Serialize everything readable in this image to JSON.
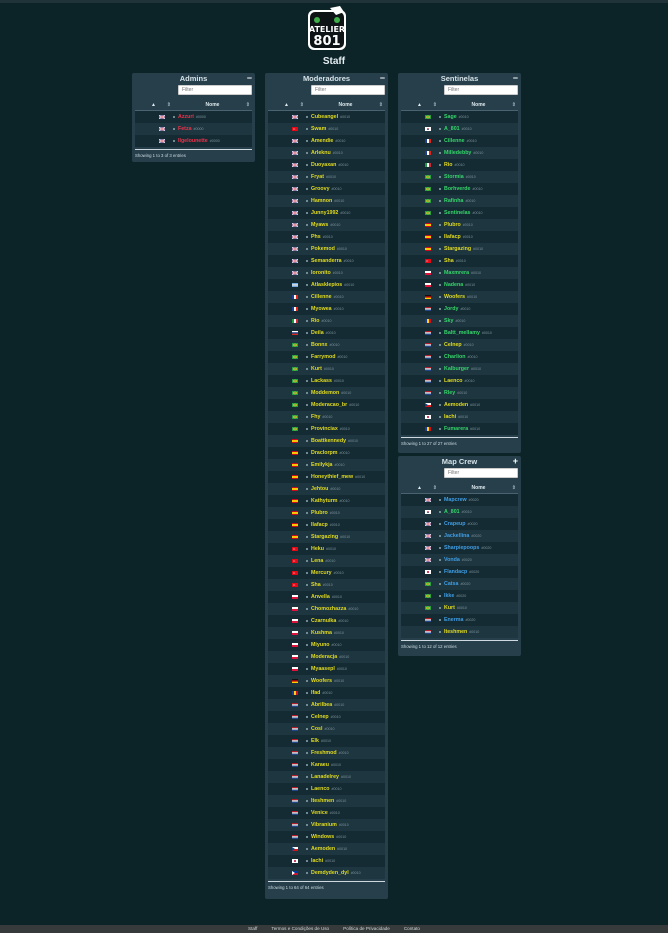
{
  "page": {
    "title": "Staff"
  },
  "logo": {
    "line1": "ATELIER",
    "line2": "801"
  },
  "colors": {
    "yellow": "#e2dc1d",
    "green": "#35d66a",
    "red": "#f0304a",
    "blue": "#3f9ee6",
    "panel": "#263f4b",
    "background": "#0c2328"
  },
  "panels": {
    "admins": {
      "title": "Admins",
      "toggle": "−",
      "filter_placeholder": "Filter",
      "col_name": "Nome",
      "info": "Showing 1 to 3 of 3 entries",
      "rows": [
        {
          "flag": "flag-uk",
          "name": "Azzuri",
          "tag": "#0000",
          "color": "#f0304a"
        },
        {
          "flag": "flag-uk",
          "name": "Fetza",
          "tag": "#0000",
          "color": "#f0304a"
        },
        {
          "flag": "flag-uk",
          "name": "Ilgelounette",
          "tag": "#0000",
          "color": "#f0304a"
        }
      ]
    },
    "moderadores": {
      "title": "Moderadores",
      "toggle": "−",
      "filter_placeholder": "Filter",
      "col_name": "Nome",
      "info": "Showing 1 to 64 of 64 entries",
      "rows": [
        {
          "flag": "flag-uk",
          "name": "Cubeangel",
          "tag": "#0010",
          "color": "#e2dc1d"
        },
        {
          "flag": "flag-tr",
          "name": "Swam",
          "tag": "#0010",
          "color": "#e2dc1d"
        },
        {
          "flag": "flag-uk",
          "name": "Amendie",
          "tag": "#0010",
          "color": "#e2dc1d"
        },
        {
          "flag": "flag-uk",
          "name": "Arleknu",
          "tag": "#0010",
          "color": "#e2dc1d"
        },
        {
          "flag": "flag-uk",
          "name": "Duoyaxan",
          "tag": "#0010",
          "color": "#e2dc1d"
        },
        {
          "flag": "flag-uk",
          "name": "Fryat",
          "tag": "#0010",
          "color": "#e2dc1d"
        },
        {
          "flag": "flag-uk",
          "name": "Groovy",
          "tag": "#0010",
          "color": "#e2dc1d"
        },
        {
          "flag": "flag-uk",
          "name": "Hamnon",
          "tag": "#0010",
          "color": "#e2dc1d"
        },
        {
          "flag": "flag-uk",
          "name": "Junny1992",
          "tag": "#0010",
          "color": "#e2dc1d"
        },
        {
          "flag": "flag-uk",
          "name": "Myaws",
          "tag": "#0010",
          "color": "#e2dc1d"
        },
        {
          "flag": "flag-uk",
          "name": "Phs",
          "tag": "#0010",
          "color": "#e2dc1d"
        },
        {
          "flag": "flag-uk",
          "name": "Pokemod",
          "tag": "#0010",
          "color": "#e2dc1d"
        },
        {
          "flag": "flag-uk",
          "name": "Semanderra",
          "tag": "#0010",
          "color": "#e2dc1d"
        },
        {
          "flag": "flag-uk",
          "name": "Ioronito",
          "tag": "#0010",
          "color": "#e2dc1d"
        },
        {
          "flag": "flag-ar",
          "name": "Atlasklepios",
          "tag": "#0010",
          "color": "#e2dc1d"
        },
        {
          "flag": "flag-fr",
          "name": "Cillenne",
          "tag": "#0010",
          "color": "#e2dc1d"
        },
        {
          "flag": "flag-fr",
          "name": "Myowea",
          "tag": "#0010",
          "color": "#e2dc1d"
        },
        {
          "flag": "flag-it",
          "name": "Rio",
          "tag": "#0010",
          "color": "#e2dc1d"
        },
        {
          "flag": "flag-ru",
          "name": "Deila",
          "tag": "#0010",
          "color": "#e2dc1d"
        },
        {
          "flag": "flag-br",
          "name": "Bonnx",
          "tag": "#0010",
          "color": "#e2dc1d"
        },
        {
          "flag": "flag-br",
          "name": "Farrymod",
          "tag": "#0010",
          "color": "#e2dc1d"
        },
        {
          "flag": "flag-br",
          "name": "Kurt",
          "tag": "#0010",
          "color": "#e2dc1d"
        },
        {
          "flag": "flag-br",
          "name": "Lackass",
          "tag": "#0010",
          "color": "#e2dc1d"
        },
        {
          "flag": "flag-br",
          "name": "Moddemon",
          "tag": "#0010",
          "color": "#e2dc1d"
        },
        {
          "flag": "flag-br",
          "name": "Moderacao_br",
          "tag": "#0010",
          "color": "#e2dc1d"
        },
        {
          "flag": "flag-br",
          "name": "Fhy",
          "tag": "#0010",
          "color": "#e2dc1d"
        },
        {
          "flag": "flag-br",
          "name": "Provinciax",
          "tag": "#0010",
          "color": "#e2dc1d"
        },
        {
          "flag": "flag-es",
          "name": "Boattkennedy",
          "tag": "#0010",
          "color": "#e2dc1d"
        },
        {
          "flag": "flag-es",
          "name": "Draclorpm",
          "tag": "#0010",
          "color": "#e2dc1d"
        },
        {
          "flag": "flag-es",
          "name": "Emilykja",
          "tag": "#0010",
          "color": "#e2dc1d"
        },
        {
          "flag": "flag-es",
          "name": "Honeythief_mew",
          "tag": "#0010",
          "color": "#e2dc1d"
        },
        {
          "flag": "flag-es",
          "name": "Jehtou",
          "tag": "#0010",
          "color": "#e2dc1d"
        },
        {
          "flag": "flag-es",
          "name": "Kathyturm",
          "tag": "#0010",
          "color": "#e2dc1d"
        },
        {
          "flag": "flag-es",
          "name": "Plubro",
          "tag": "#0010",
          "color": "#e2dc1d"
        },
        {
          "flag": "flag-es",
          "name": "Ilafacp",
          "tag": "#0010",
          "color": "#e2dc1d"
        },
        {
          "flag": "flag-es",
          "name": "Stargazing",
          "tag": "#0010",
          "color": "#e2dc1d"
        },
        {
          "flag": "flag-tr",
          "name": "Heku",
          "tag": "#0010",
          "color": "#e2dc1d"
        },
        {
          "flag": "flag-tr",
          "name": "Lena",
          "tag": "#0010",
          "color": "#e2dc1d"
        },
        {
          "flag": "flag-tr",
          "name": "Mercury",
          "tag": "#0010",
          "color": "#e2dc1d"
        },
        {
          "flag": "flag-tr",
          "name": "Sha",
          "tag": "#0010",
          "color": "#e2dc1d"
        },
        {
          "flag": "flag-pl",
          "name": "Anvella",
          "tag": "#0010",
          "color": "#e2dc1d"
        },
        {
          "flag": "flag-pl",
          "name": "Chomozhazza",
          "tag": "#0010",
          "color": "#e2dc1d"
        },
        {
          "flag": "flag-pl",
          "name": "Czarnulka",
          "tag": "#0010",
          "color": "#e2dc1d"
        },
        {
          "flag": "flag-pl",
          "name": "Kushma",
          "tag": "#0010",
          "color": "#e2dc1d"
        },
        {
          "flag": "flag-pl",
          "name": "Miyuno",
          "tag": "#0010",
          "color": "#e2dc1d"
        },
        {
          "flag": "flag-pl",
          "name": "Moderacja",
          "tag": "#0010",
          "color": "#e2dc1d"
        },
        {
          "flag": "flag-pl",
          "name": "Myaasepl",
          "tag": "#0010",
          "color": "#e2dc1d"
        },
        {
          "flag": "flag-de",
          "name": "Woofers",
          "tag": "#0010",
          "color": "#e2dc1d"
        },
        {
          "flag": "flag-ro",
          "name": "Ifad",
          "tag": "#0010",
          "color": "#e2dc1d"
        },
        {
          "flag": "flag-nl",
          "name": "Abrilbea",
          "tag": "#0010",
          "color": "#e2dc1d"
        },
        {
          "flag": "flag-nl",
          "name": "Celnep",
          "tag": "#0010",
          "color": "#e2dc1d"
        },
        {
          "flag": "flag-nl",
          "name": "Cosl",
          "tag": "#0010",
          "color": "#e2dc1d"
        },
        {
          "flag": "flag-nl",
          "name": "Elk",
          "tag": "#0010",
          "color": "#e2dc1d"
        },
        {
          "flag": "flag-nl",
          "name": "Freshmod",
          "tag": "#0010",
          "color": "#e2dc1d"
        },
        {
          "flag": "flag-nl",
          "name": "Karaeu",
          "tag": "#0010",
          "color": "#e2dc1d"
        },
        {
          "flag": "flag-nl",
          "name": "Lanadelrey",
          "tag": "#0010",
          "color": "#e2dc1d"
        },
        {
          "flag": "flag-nl",
          "name": "Laenco",
          "tag": "#0010",
          "color": "#e2dc1d"
        },
        {
          "flag": "flag-nl",
          "name": "Iteshmen",
          "tag": "#0010",
          "color": "#e2dc1d"
        },
        {
          "flag": "flag-nl",
          "name": "Venice",
          "tag": "#0010",
          "color": "#e2dc1d"
        },
        {
          "flag": "flag-nl",
          "name": "Vibranium",
          "tag": "#0010",
          "color": "#e2dc1d"
        },
        {
          "flag": "flag-nl",
          "name": "Windows",
          "tag": "#0010",
          "color": "#e2dc1d"
        },
        {
          "flag": "flag-cz",
          "name": "Aemoden",
          "tag": "#0010",
          "color": "#e2dc1d"
        },
        {
          "flag": "flag-jp",
          "name": "Iachi",
          "tag": "#0010",
          "color": "#e2dc1d"
        },
        {
          "flag": "flag-ph",
          "name": "Demdyden_dyl",
          "tag": "#0010",
          "color": "#e2dc1d"
        }
      ]
    },
    "sentinelas": {
      "title": "Sentinelas",
      "toggle": "−",
      "filter_placeholder": "Filter",
      "col_name": "Nome",
      "info": "Showing 1 to 27 of 27 entries",
      "rows": [
        {
          "flag": "flag-br",
          "name": "Sage",
          "tag": "#0010",
          "color": "#35d66a"
        },
        {
          "flag": "flag-kr",
          "name": "A_801",
          "tag": "#0010",
          "color": "#35d66a"
        },
        {
          "flag": "flag-fr",
          "name": "Cillenne",
          "tag": "#0010",
          "color": "#35d66a"
        },
        {
          "flag": "flag-fr",
          "name": "Milledebby",
          "tag": "#0010",
          "color": "#35d66a"
        },
        {
          "flag": "flag-it",
          "name": "Rio",
          "tag": "#0010",
          "color": "#e2dc1d"
        },
        {
          "flag": "flag-br",
          "name": "Stormia",
          "tag": "#0010",
          "color": "#35d66a"
        },
        {
          "flag": "flag-br",
          "name": "Borhverde",
          "tag": "#0010",
          "color": "#35d66a"
        },
        {
          "flag": "flag-br",
          "name": "Rafinha",
          "tag": "#0010",
          "color": "#35d66a"
        },
        {
          "flag": "flag-br",
          "name": "Sentinelas",
          "tag": "#0010",
          "color": "#35d66a"
        },
        {
          "flag": "flag-es",
          "name": "Plubro",
          "tag": "#0010",
          "color": "#e2dc1d"
        },
        {
          "flag": "flag-es",
          "name": "Ilafacp",
          "tag": "#0010",
          "color": "#e2dc1d"
        },
        {
          "flag": "flag-es",
          "name": "Stargazing",
          "tag": "#0010",
          "color": "#e2dc1d"
        },
        {
          "flag": "flag-tr",
          "name": "Sha",
          "tag": "#0010",
          "color": "#e2dc1d"
        },
        {
          "flag": "flag-pl",
          "name": "Maxmrera",
          "tag": "#0010",
          "color": "#35d66a"
        },
        {
          "flag": "flag-pl",
          "name": "Nadena",
          "tag": "#0010",
          "color": "#35d66a"
        },
        {
          "flag": "flag-de",
          "name": "Woofers",
          "tag": "#0010",
          "color": "#e2dc1d"
        },
        {
          "flag": "flag-nl",
          "name": "Jordy",
          "tag": "#0010",
          "color": "#35d66a"
        },
        {
          "flag": "flag-ro",
          "name": "Sky",
          "tag": "#0010",
          "color": "#35d66a"
        },
        {
          "flag": "flag-nl",
          "name": "Baltt_mellamy",
          "tag": "#0010",
          "color": "#35d66a"
        },
        {
          "flag": "flag-nl",
          "name": "Celnep",
          "tag": "#0010",
          "color": "#e2dc1d"
        },
        {
          "flag": "flag-nl",
          "name": "Charlion",
          "tag": "#0010",
          "color": "#35d66a"
        },
        {
          "flag": "flag-nl",
          "name": "Kalburger",
          "tag": "#0010",
          "color": "#35d66a"
        },
        {
          "flag": "flag-nl",
          "name": "Laenco",
          "tag": "#0010",
          "color": "#e2dc1d"
        },
        {
          "flag": "flag-nl",
          "name": "Rley",
          "tag": "#0010",
          "color": "#35d66a"
        },
        {
          "flag": "flag-cz",
          "name": "Aemoden",
          "tag": "#0010",
          "color": "#e2dc1d"
        },
        {
          "flag": "flag-jp",
          "name": "Iachi",
          "tag": "#0010",
          "color": "#e2dc1d"
        },
        {
          "flag": "flag-ro",
          "name": "Fumarera",
          "tag": "#0010",
          "color": "#35d66a"
        }
      ]
    },
    "mapcrew": {
      "title": "Map Crew",
      "toggle": "+",
      "filter_placeholder": "Filter",
      "col_name": "Nome",
      "info": "Showing 1 to 12 of 12 entries",
      "rows": [
        {
          "flag": "flag-uk",
          "name": "Mapcrew",
          "tag": "#0020",
          "color": "#3f9ee6"
        },
        {
          "flag": "flag-kr",
          "name": "A_801",
          "tag": "#0010",
          "color": "#35d66a"
        },
        {
          "flag": "flag-uk",
          "name": "Crapeup",
          "tag": "#0020",
          "color": "#3f9ee6"
        },
        {
          "flag": "flag-uk",
          "name": "Jackellina",
          "tag": "#0020",
          "color": "#3f9ee6"
        },
        {
          "flag": "flag-uk",
          "name": "Sharpiepoops",
          "tag": "#0020",
          "color": "#3f9ee6"
        },
        {
          "flag": "flag-uk",
          "name": "Vonda",
          "tag": "#0020",
          "color": "#3f9ee6"
        },
        {
          "flag": "flag-jp",
          "name": "Flandacp",
          "tag": "#0020",
          "color": "#3f9ee6"
        },
        {
          "flag": "flag-br",
          "name": "Catsa",
          "tag": "#0020",
          "color": "#3f9ee6"
        },
        {
          "flag": "flag-br",
          "name": "Ikke",
          "tag": "#0020",
          "color": "#3f9ee6"
        },
        {
          "flag": "flag-br",
          "name": "Kurt",
          "tag": "#0010",
          "color": "#e2dc1d"
        },
        {
          "flag": "flag-nl",
          "name": "Enerma",
          "tag": "#0020",
          "color": "#3f9ee6"
        },
        {
          "flag": "flag-nl",
          "name": "Iteshmen",
          "tag": "#0010",
          "color": "#e2dc1d"
        }
      ]
    }
  },
  "footer": {
    "links": [
      "Staff",
      "Termos e Condições de Uso",
      "Política de Privacidade",
      "Contato"
    ]
  }
}
